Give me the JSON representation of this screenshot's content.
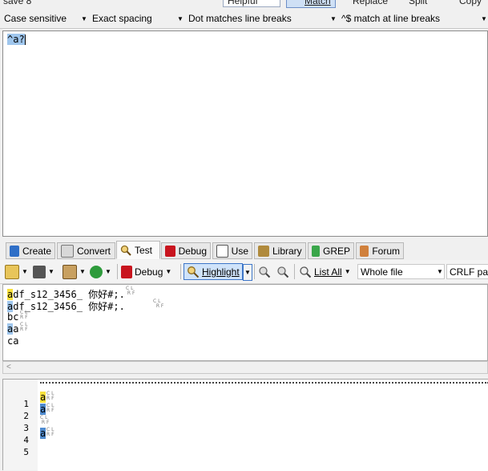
{
  "top_partial": {
    "left_text": "save 8",
    "helpful": "Helpful",
    "match": "Match",
    "replace": "Replace",
    "split": "Split",
    "copy": "Copy"
  },
  "options": {
    "case": "Case sensitive",
    "spacing": "Exact spacing",
    "dot": "Dot matches line breaks",
    "anchors": "^$ match at line breaks"
  },
  "regex": {
    "text": "^a?"
  },
  "tabs": [
    {
      "label": "Create",
      "icon": "create-icon"
    },
    {
      "label": "Convert",
      "icon": "convert-icon"
    },
    {
      "label": "Test",
      "icon": "test-magnifier-icon",
      "active": true
    },
    {
      "label": "Debug",
      "icon": "debug-icon"
    },
    {
      "label": "Use",
      "icon": "use-icon"
    },
    {
      "label": "Library",
      "icon": "library-icon"
    },
    {
      "label": "GREP",
      "icon": "grep-icon"
    },
    {
      "label": "Forum",
      "icon": "forum-icon"
    }
  ],
  "testbar": {
    "debug": "Debug",
    "highlight": "Highlight",
    "list_all": "List All",
    "scope": "Whole file",
    "line_break": "CRLF pairs"
  },
  "subject": {
    "lines": [
      {
        "pre": "a",
        "rest": "df_s12_3456_ 你好#;."
      },
      {
        "pre": "a",
        "rest": "df_s12_3456_ 你好#;."
      },
      {
        "pre": "",
        "rest": "bc"
      },
      {
        "pre": "a",
        "rest": "a"
      },
      {
        "pre": "",
        "rest": "ca"
      }
    ],
    "cr": "C",
    "lf": "L",
    "r": "R",
    "f": "F"
  },
  "results": {
    "line_numbers": [
      "1",
      "2",
      "3",
      "4",
      "5"
    ],
    "lines": [
      "a",
      "a",
      "",
      "a",
      ""
    ]
  },
  "colors": {
    "match_yellow": "#f7e03c",
    "match_blue": "#9fc6ed",
    "accent": "#3d76c8"
  }
}
